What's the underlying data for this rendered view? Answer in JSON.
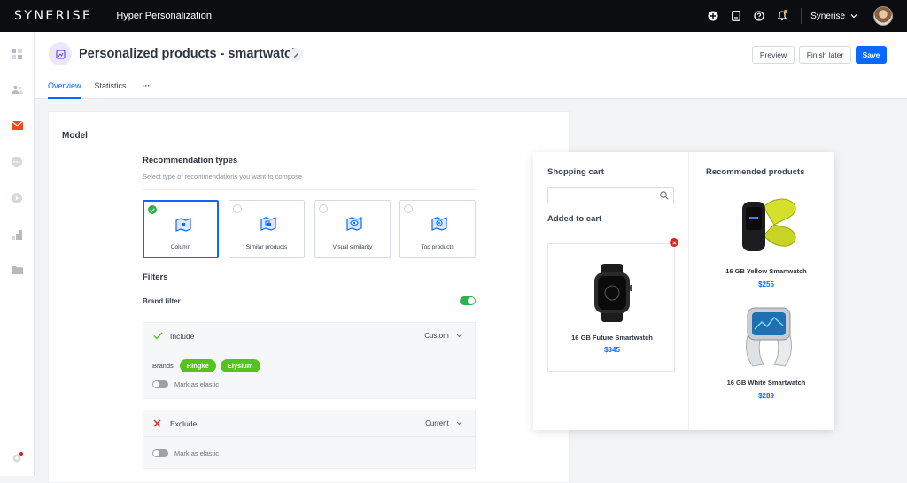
{
  "topbar": {
    "logo": "SYNERISE",
    "app_name": "Hyper Personalization",
    "user_name": "Synerise",
    "icons": [
      "plus-circle-icon",
      "document-icon",
      "help-icon",
      "notification-icon",
      "chevron-down-icon"
    ]
  },
  "sidebar": {
    "icons": [
      "dashboard-icon",
      "customers-icon",
      "campaigns-icon",
      "more-icon",
      "play-icon",
      "analytics-icon",
      "folder-icon",
      "settings-icon"
    ]
  },
  "header": {
    "title": "Personalized products - smartwatch",
    "buttons": {
      "preview": "Preview",
      "finish_later": "Finish later",
      "save": "Save"
    },
    "tabs": {
      "overview": "Overview",
      "statistics": "Statistics",
      "more": "···"
    }
  },
  "model": {
    "title": "Model",
    "recommendation": {
      "title": "Recommendation types",
      "description": "Select type of recommendations you want to compose",
      "types": [
        {
          "label": "Column",
          "selected": true
        },
        {
          "label": "Similar products",
          "selected": false
        },
        {
          "label": "Visual similarity",
          "selected": false
        },
        {
          "label": "Top products",
          "selected": false
        }
      ]
    },
    "filters": {
      "title": "Filters",
      "brand_filter_label": "Brand filter",
      "brand_filter_enabled": true,
      "include": {
        "label": "Include",
        "mode": "Custom",
        "brands_label": "Brands",
        "brands": [
          "Ringke",
          "Elysium"
        ],
        "elastic_label": "Mark as elastic"
      },
      "exclude": {
        "label": "Exclude",
        "mode": "Current",
        "elastic_label": "Mark as elastic"
      }
    }
  },
  "preview": {
    "cart_title": "Shopping cart",
    "added_title": "Added to cart",
    "recommended_title": "Recommended products",
    "cart_item": {
      "name": "16 GB Future Smartwatch",
      "price": "$345"
    },
    "recommended": [
      {
        "name": "16 GB Yellow Smartwatch",
        "price": "$255"
      },
      {
        "name": "16 GB White Smartwatch",
        "price": "$289"
      }
    ]
  },
  "colors": {
    "accent": "#0b68ff",
    "success": "#52c41a",
    "danger": "#e02020",
    "topbar": "#0b0d10"
  }
}
